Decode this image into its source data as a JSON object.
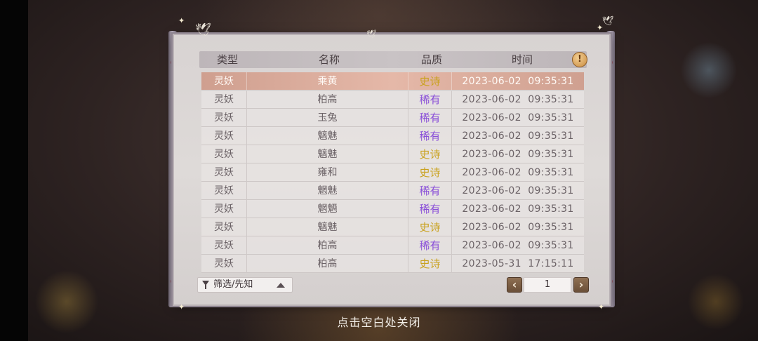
{
  "header": {
    "col_type": "类型",
    "col_name": "名称",
    "col_quality": "品质",
    "col_time": "时间",
    "info_icon": "!"
  },
  "colors": {
    "epic": "#c9a11d",
    "rare": "#8a4fd8",
    "selected_row": "#e0b1a1"
  },
  "rows": [
    {
      "type": "灵妖",
      "name": "乘黄",
      "quality": "史诗",
      "quality_kind": "epic",
      "time": "2023-06-02  09:35:31",
      "selected": true
    },
    {
      "type": "灵妖",
      "name": "柏高",
      "quality": "稀有",
      "quality_kind": "rare",
      "time": "2023-06-02  09:35:31"
    },
    {
      "type": "灵妖",
      "name": "玉兔",
      "quality": "稀有",
      "quality_kind": "rare",
      "time": "2023-06-02  09:35:31"
    },
    {
      "type": "灵妖",
      "name": "魑魅",
      "quality": "稀有",
      "quality_kind": "rare",
      "time": "2023-06-02  09:35:31"
    },
    {
      "type": "灵妖",
      "name": "魑魅",
      "quality": "史诗",
      "quality_kind": "epic",
      "time": "2023-06-02  09:35:31"
    },
    {
      "type": "灵妖",
      "name": "雍和",
      "quality": "史诗",
      "quality_kind": "epic",
      "time": "2023-06-02  09:35:31"
    },
    {
      "type": "灵妖",
      "name": "魍魅",
      "quality": "稀有",
      "quality_kind": "rare",
      "time": "2023-06-02  09:35:31"
    },
    {
      "type": "灵妖",
      "name": "魍魉",
      "quality": "稀有",
      "quality_kind": "rare",
      "time": "2023-06-02  09:35:31"
    },
    {
      "type": "灵妖",
      "name": "魑魅",
      "quality": "史诗",
      "quality_kind": "epic",
      "time": "2023-06-02  09:35:31"
    },
    {
      "type": "灵妖",
      "name": "柏高",
      "quality": "稀有",
      "quality_kind": "rare",
      "time": "2023-06-02  09:35:31"
    },
    {
      "type": "灵妖",
      "name": "柏高",
      "quality": "史诗",
      "quality_kind": "epic",
      "time": "2023-05-31  17:15:11"
    }
  ],
  "footer": {
    "filter_label": "筛选/先知",
    "prev_label": "‹",
    "next_label": "›",
    "page": "1"
  },
  "close_hint": "点击空白处关闭"
}
